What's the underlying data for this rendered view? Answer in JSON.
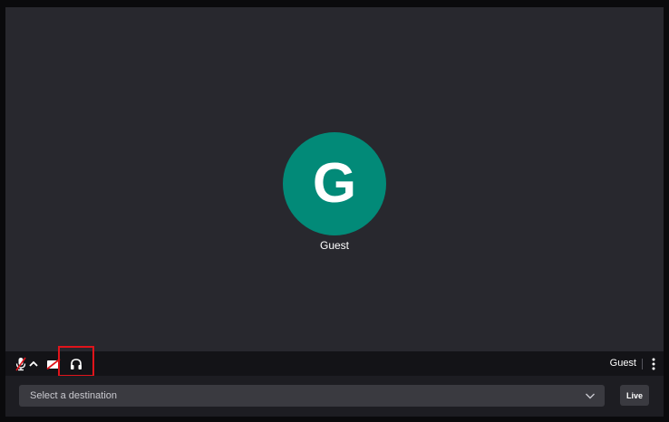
{
  "participant": {
    "initial": "G",
    "name": "Guest",
    "avatar_color": "#028a78"
  },
  "toolbar": {
    "icons": [
      "microphone-muted-icon",
      "chevron-up-icon",
      "camera-off-icon",
      "headphones-icon",
      "more-vertical-icon"
    ],
    "username": "Guest",
    "highlight_color": "#e0141b"
  },
  "bottom": {
    "destination_placeholder": "Select a destination",
    "live_label": "Live"
  }
}
